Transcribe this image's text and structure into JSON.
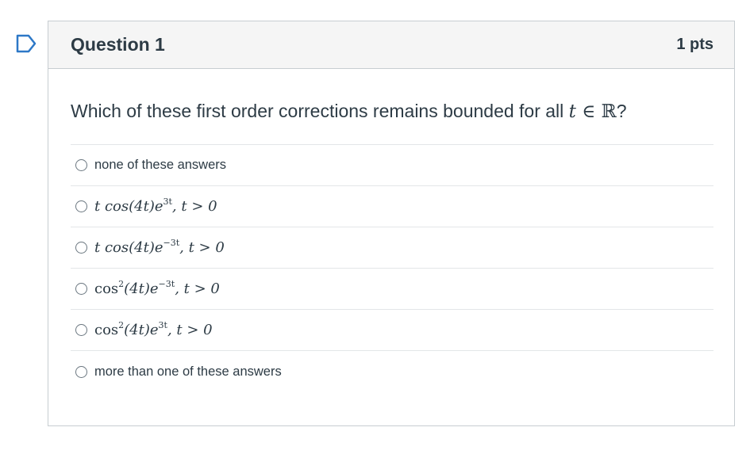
{
  "question": {
    "title": "Question 1",
    "points": "1 pts",
    "prompt_prefix": "Which of these first order corrections remains bounded for all ",
    "prompt_math_var": "t",
    "prompt_math_rel": " ∈ ",
    "prompt_math_set": "ℝ",
    "prompt_suffix": "?"
  },
  "answers": [
    {
      "text": "none of these answers"
    },
    {
      "f": "t cos(4t)e",
      "exp": "3t",
      "cond": ", t > 0"
    },
    {
      "f": "t cos(4t)e",
      "exp": "−3t",
      "cond": ", t > 0"
    },
    {
      "f": "cos",
      "pow": "2",
      "f2": "(4t)e",
      "exp": "−3t",
      "cond": ", t > 0"
    },
    {
      "f": "cos",
      "pow": "2",
      "f2": "(4t)e",
      "exp": "3t",
      "cond": ", t > 0"
    },
    {
      "text": "more than one of these answers"
    }
  ],
  "colors": {
    "text": "#2d3b45",
    "border": "#c7cdd1",
    "header_bg": "#f5f5f5",
    "flag": "#2d78c7"
  },
  "icons": {
    "flag": "bookmark-flag-icon",
    "radio": "radio-button-icon"
  }
}
